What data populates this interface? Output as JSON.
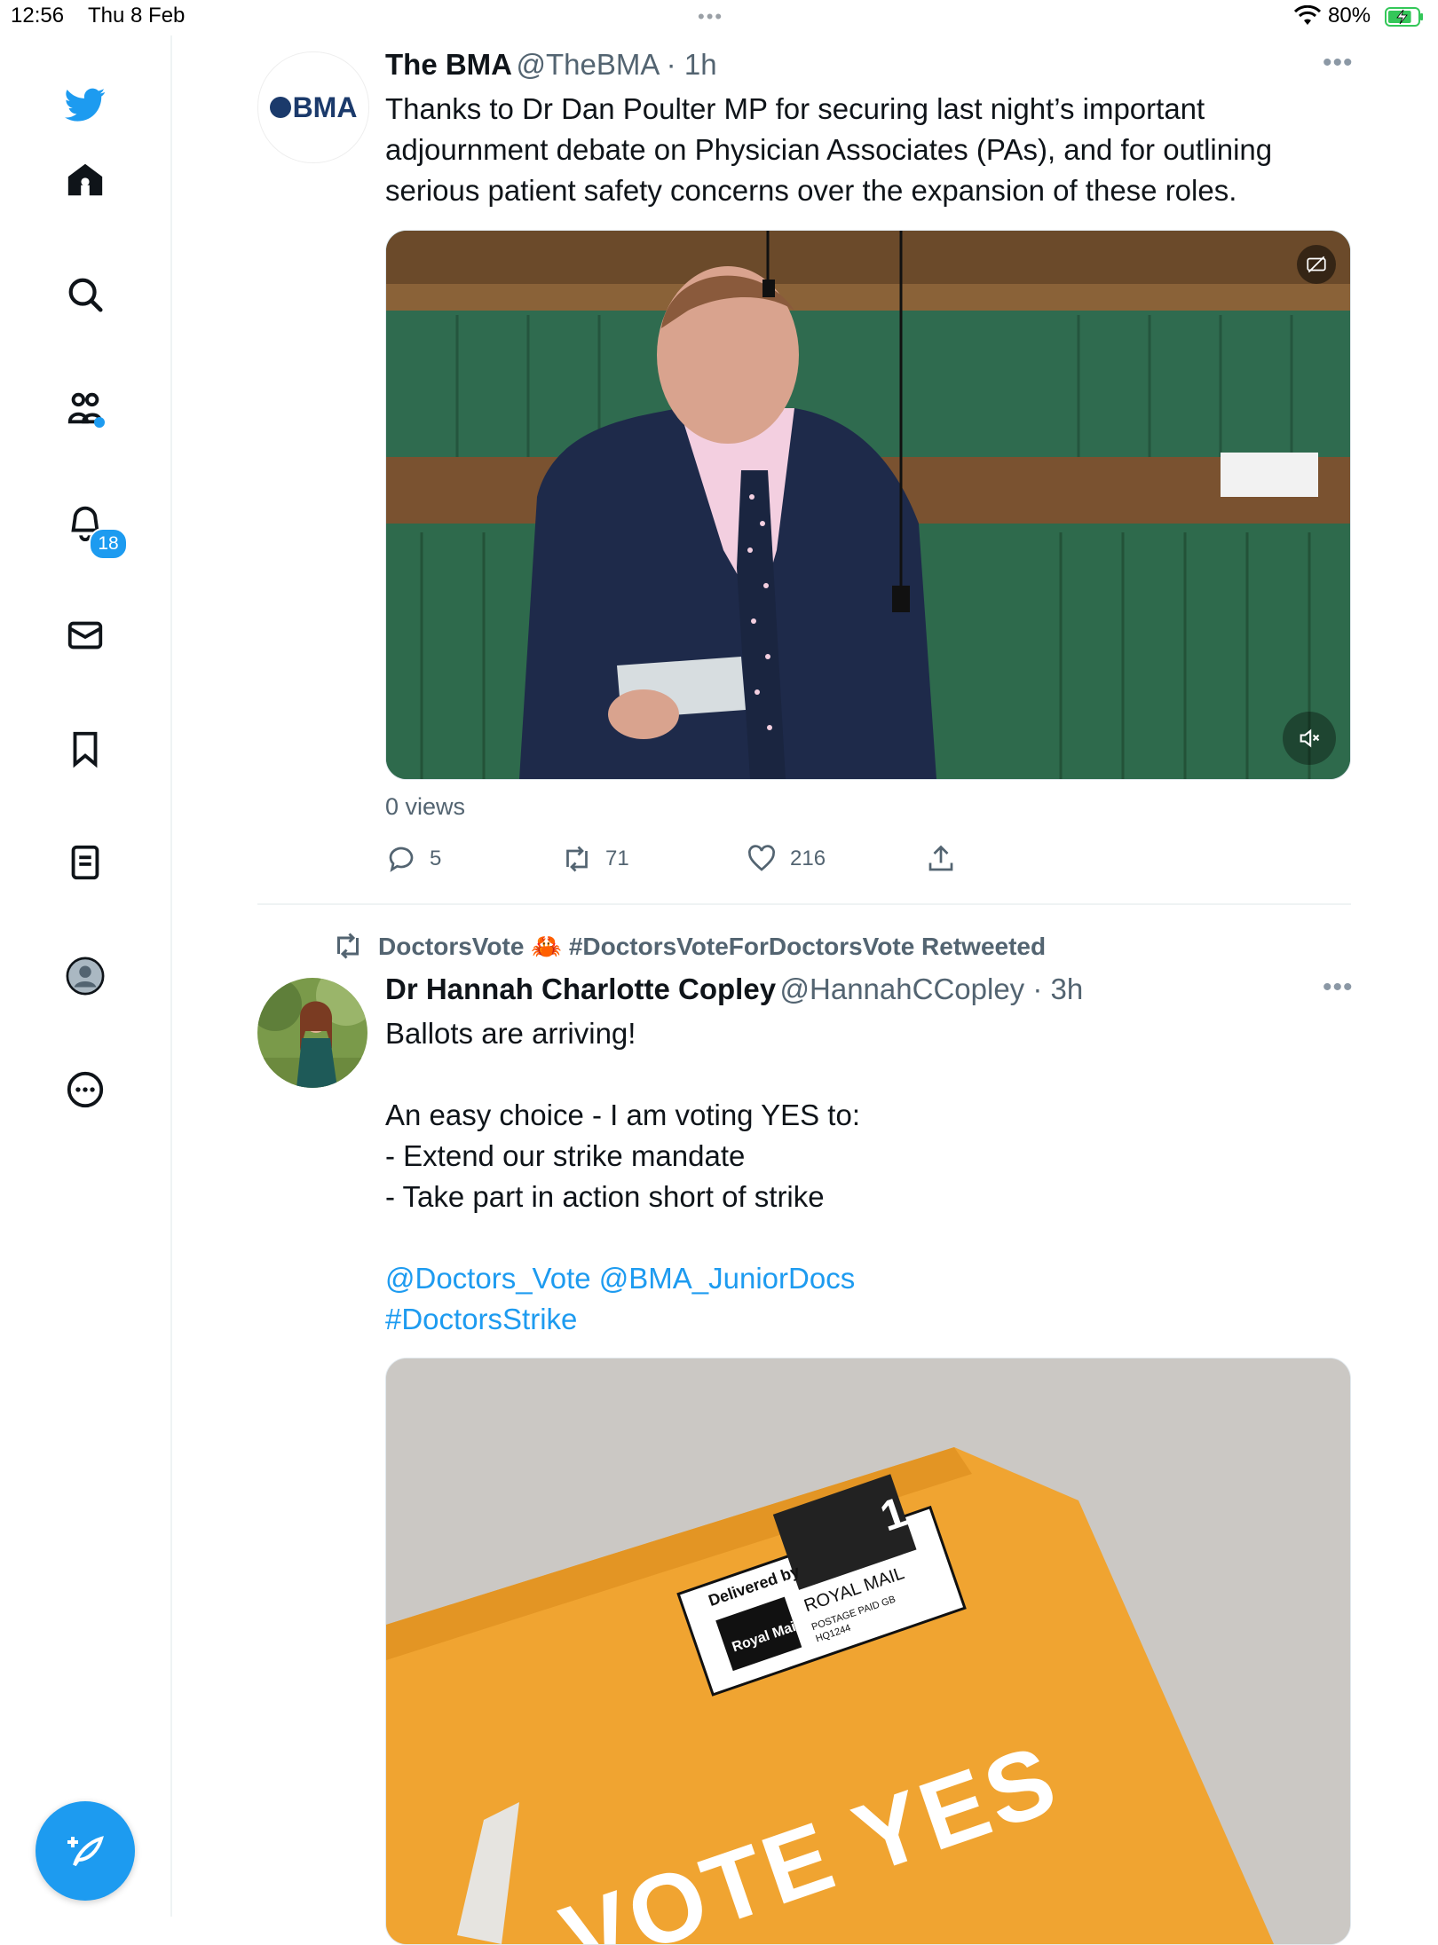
{
  "status_bar": {
    "time": "12:56",
    "date": "Thu 8 Feb",
    "battery_percent": "80%",
    "battery_level": 0.8
  },
  "sidebar": {
    "items": [
      {
        "name": "twitter-logo",
        "icon": "bird-icon"
      },
      {
        "name": "home",
        "icon": "home-icon"
      },
      {
        "name": "explore",
        "icon": "search-icon"
      },
      {
        "name": "communities",
        "icon": "communities-icon"
      },
      {
        "name": "notifications",
        "icon": "bell-icon"
      },
      {
        "name": "messages",
        "icon": "mail-icon"
      },
      {
        "name": "bookmarks",
        "icon": "bookmark-icon"
      },
      {
        "name": "lists",
        "icon": "list-icon"
      },
      {
        "name": "profile",
        "icon": "profile-icon"
      },
      {
        "name": "more",
        "icon": "more-circle-icon"
      }
    ],
    "notification_count": "18",
    "compose_icon": "compose-icon"
  },
  "tweets": [
    {
      "author_name": "The BMA",
      "handle": "@TheBMA",
      "time": "1h",
      "avatar_text": "BMA",
      "text": "Thanks to Dr Dan Poulter MP for securing last night’s important adjournment debate on Physician Associates (PAs), and for outlining serious patient safety concerns over the expansion of these roles.",
      "views": "0 views",
      "replies": "5",
      "retweets": "71",
      "likes": "216"
    },
    {
      "retweeted_by": "DoctorsVote 🦀 #DoctorsVoteForDoctorsVote Retweeted",
      "author_name": "Dr Hannah Charlotte Copley",
      "handle": "@HannahCCopley",
      "time": "3h",
      "text_lines": [
        "Ballots are arriving!",
        "",
        "An easy choice - I am voting YES to:",
        "- Extend our strike mandate",
        "- Take part in action short of strike"
      ],
      "mentions": "@Doctors_Vote @BMA_JuniorDocs",
      "hashtag": "#DoctorsStrike",
      "image_text": {
        "delivered_by": "Delivered by",
        "royal_mail_logo": "Royal Mail",
        "royal_mail_label": "ROYAL MAIL",
        "postage": "POSTAGE PAID GB",
        "code": "HQ1244",
        "vote": "VOTE YES",
        "class_number": "1"
      }
    }
  ]
}
